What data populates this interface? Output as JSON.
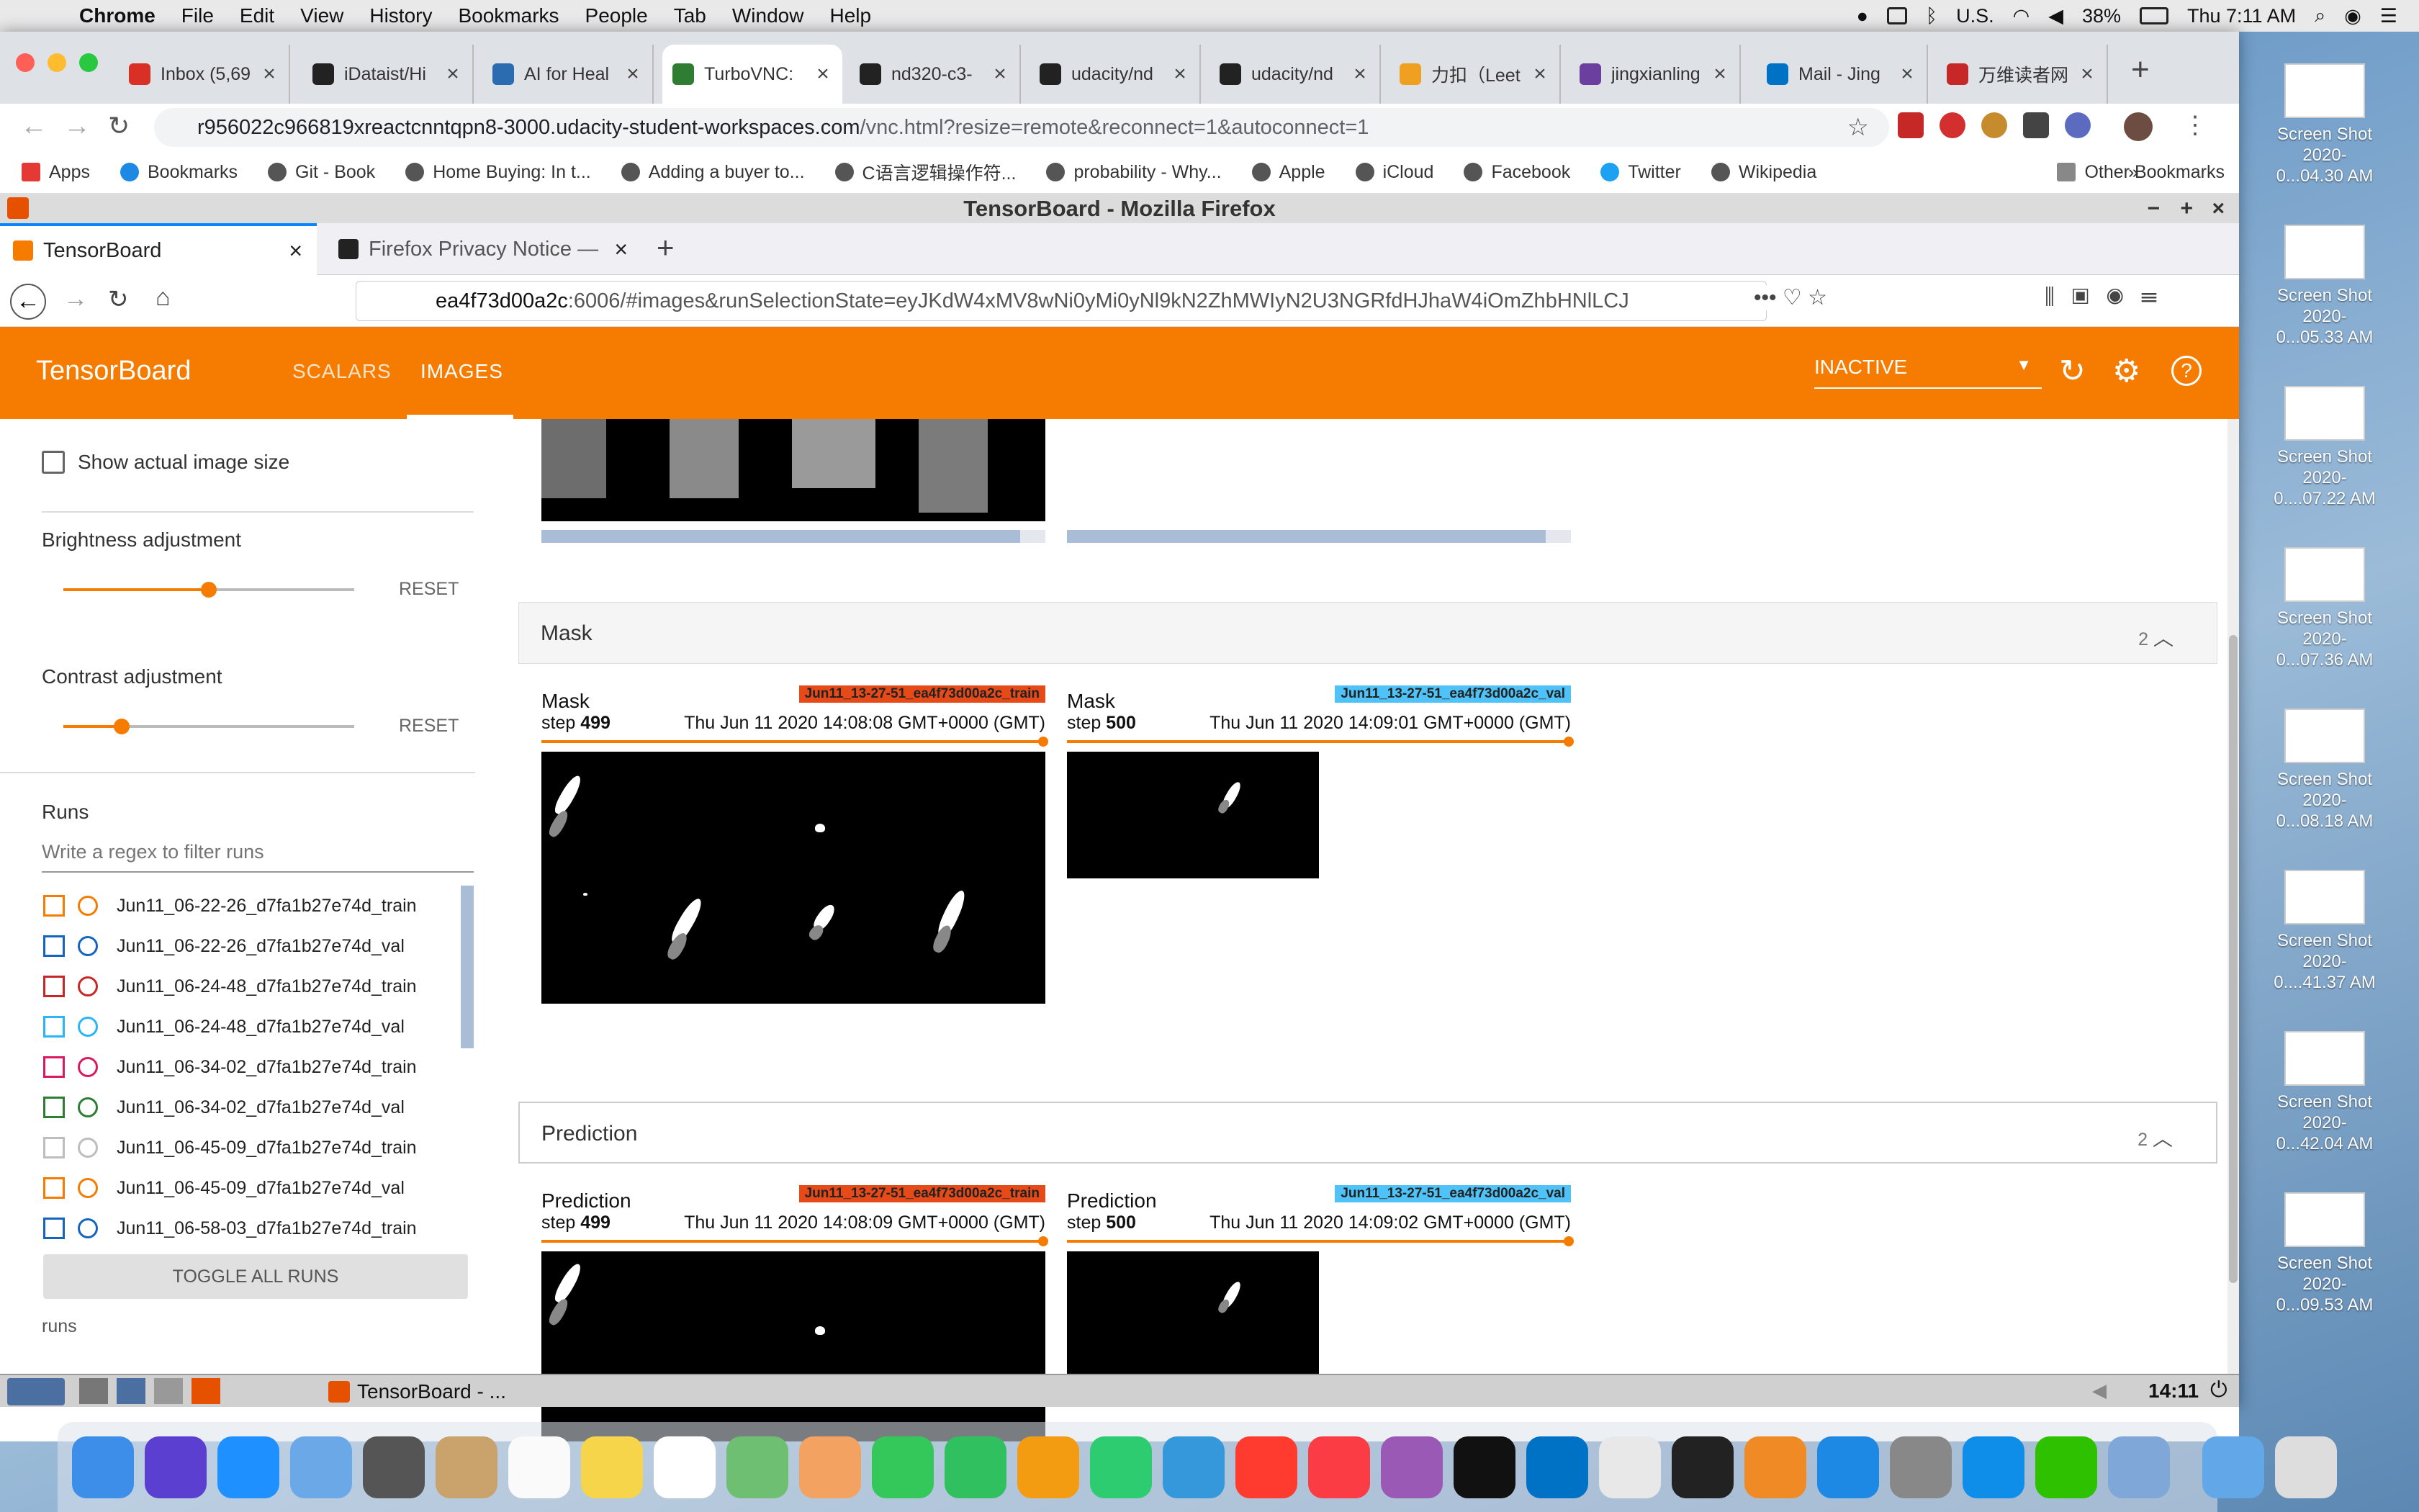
{
  "menubar": {
    "app": "Chrome",
    "items": [
      "File",
      "Edit",
      "View",
      "History",
      "Bookmarks",
      "People",
      "Tab",
      "Window",
      "Help"
    ],
    "input_source": "U.S.",
    "battery": "38%",
    "clock": "Thu 7:11 AM"
  },
  "chrome": {
    "tabs": [
      {
        "label": "Inbox (5,69",
        "color": "#d93025"
      },
      {
        "label": "iDataist/Hi",
        "color": "#222222"
      },
      {
        "label": "AI for Heal",
        "color": "#2b6cb0"
      },
      {
        "label": "TurboVNC:",
        "color": "#2e7d32"
      },
      {
        "label": "nd320-c3-",
        "color": "#222222"
      },
      {
        "label": "udacity/nd",
        "color": "#222222"
      },
      {
        "label": "udacity/nd",
        "color": "#222222"
      },
      {
        "label": "力扣（Leet",
        "color": "#f0a020"
      },
      {
        "label": "jingxianling",
        "color": "#6b3fa0"
      },
      {
        "label": "Mail - Jing",
        "color": "#0072c6"
      },
      {
        "label": "万维读者网",
        "color": "#c62828"
      }
    ],
    "url_host": "r956022c966819xreactcnntqpn8-3000.udacity-student-workspaces.com",
    "url_path": "/vnc.html?resize=remote&reconnect=1&autoconnect=1",
    "bookmarks": [
      "Apps",
      "Bookmarks",
      "Git - Book",
      "Home Buying: In t...",
      "Adding a buyer to...",
      "C语言逻辑操作符...",
      "probability - Why...",
      "Apple",
      "iCloud",
      "Facebook",
      "Twitter",
      "Wikipedia"
    ],
    "other_bookmarks": "Other Bookmarks"
  },
  "firefox": {
    "window_title": "TensorBoard - Mozilla Firefox",
    "tabs": [
      "TensorBoard",
      "Firefox Privacy Notice —"
    ],
    "url_host": "ea4f73d00a2c",
    "url_rest": ":6006/#images&runSelectionState=eyJKdW4xMV8wNi0yMi0yNl9kN2ZhMWIyN2U3NGRfdHJhaW4iOmZhbHNlLCJ"
  },
  "tensorboard": {
    "title": "TensorBoard",
    "nav": [
      "SCALARS",
      "IMAGES"
    ],
    "status": "INACTIVE",
    "sidebar": {
      "show_actual_size": "Show actual image size",
      "brightness_label": "Brightness adjustment",
      "brightness_value": 0.5,
      "contrast_label": "Contrast adjustment",
      "contrast_value": 0.2,
      "reset": "RESET",
      "runs_label": "Runs",
      "filter_placeholder": "Write a regex to filter runs",
      "runs": [
        {
          "name": "Jun11_06-22-26_d7fa1b27e74d_train",
          "color": "#f57c00"
        },
        {
          "name": "Jun11_06-22-26_d7fa1b27e74d_val",
          "color": "#1565c0"
        },
        {
          "name": "Jun11_06-24-48_d7fa1b27e74d_train",
          "color": "#c62828"
        },
        {
          "name": "Jun11_06-24-48_d7fa1b27e74d_val",
          "color": "#29b6f6"
        },
        {
          "name": "Jun11_06-34-02_d7fa1b27e74d_train",
          "color": "#d81b60"
        },
        {
          "name": "Jun11_06-34-02_d7fa1b27e74d_val",
          "color": "#2e7d32"
        },
        {
          "name": "Jun11_06-45-09_d7fa1b27e74d_train",
          "color": "#bdbdbd"
        },
        {
          "name": "Jun11_06-45-09_d7fa1b27e74d_val",
          "color": "#f57c00"
        },
        {
          "name": "Jun11_06-58-03_d7fa1b27e74d_train",
          "color": "#1565c0"
        }
      ],
      "toggle_all": "TOGGLE ALL RUNS",
      "footer": "runs"
    },
    "panes": {
      "mask": {
        "title": "Mask",
        "count": "2",
        "cards": [
          {
            "title": "Mask",
            "step_label": "step",
            "step": "499",
            "time": "Thu Jun 11 2020 14:08:08 GMT+0000 (GMT)",
            "run": "Jun11_13-27-51_ea4f73d00a2c_train",
            "run_color": "#e64a19"
          },
          {
            "title": "Mask",
            "step_label": "step",
            "step": "500",
            "time": "Thu Jun 11 2020 14:09:01 GMT+0000 (GMT)",
            "run": "Jun11_13-27-51_ea4f73d00a2c_val",
            "run_color": "#4fc3f7"
          }
        ]
      },
      "prediction": {
        "title": "Prediction",
        "count": "2",
        "cards": [
          {
            "title": "Prediction",
            "step_label": "step",
            "step": "499",
            "time": "Thu Jun 11 2020 14:08:09 GMT+0000 (GMT)",
            "run": "Jun11_13-27-51_ea4f73d00a2c_train",
            "run_color": "#e64a19"
          },
          {
            "title": "Prediction",
            "step_label": "step",
            "step": "500",
            "time": "Thu Jun 11 2020 14:09:02 GMT+0000 (GMT)",
            "run": "Jun11_13-27-51_ea4f73d00a2c_val",
            "run_color": "#4fc3f7"
          }
        ]
      }
    }
  },
  "vnc_taskbar": {
    "window": "TensorBoard - ...",
    "clock": "14:11"
  },
  "desktop": {
    "screenshots": [
      {
        "line1": "Screen Shot",
        "line2": "2020-0...04.30 AM"
      },
      {
        "line1": "Screen Shot",
        "line2": "2020-0...05.33 AM"
      },
      {
        "line1": "Screen Shot",
        "line2": "2020-0....07.22 AM"
      },
      {
        "line1": "Screen Shot",
        "line2": "2020-0...07.36 AM"
      },
      {
        "line1": "Screen Shot",
        "line2": "2020-0...08.18 AM"
      },
      {
        "line1": "Screen Shot",
        "line2": "2020-0....41.37 AM"
      },
      {
        "line1": "Screen Shot",
        "line2": "2020-0...42.04 AM"
      },
      {
        "line1": "Screen Shot",
        "line2": "2020-0...09.53 AM"
      }
    ]
  }
}
